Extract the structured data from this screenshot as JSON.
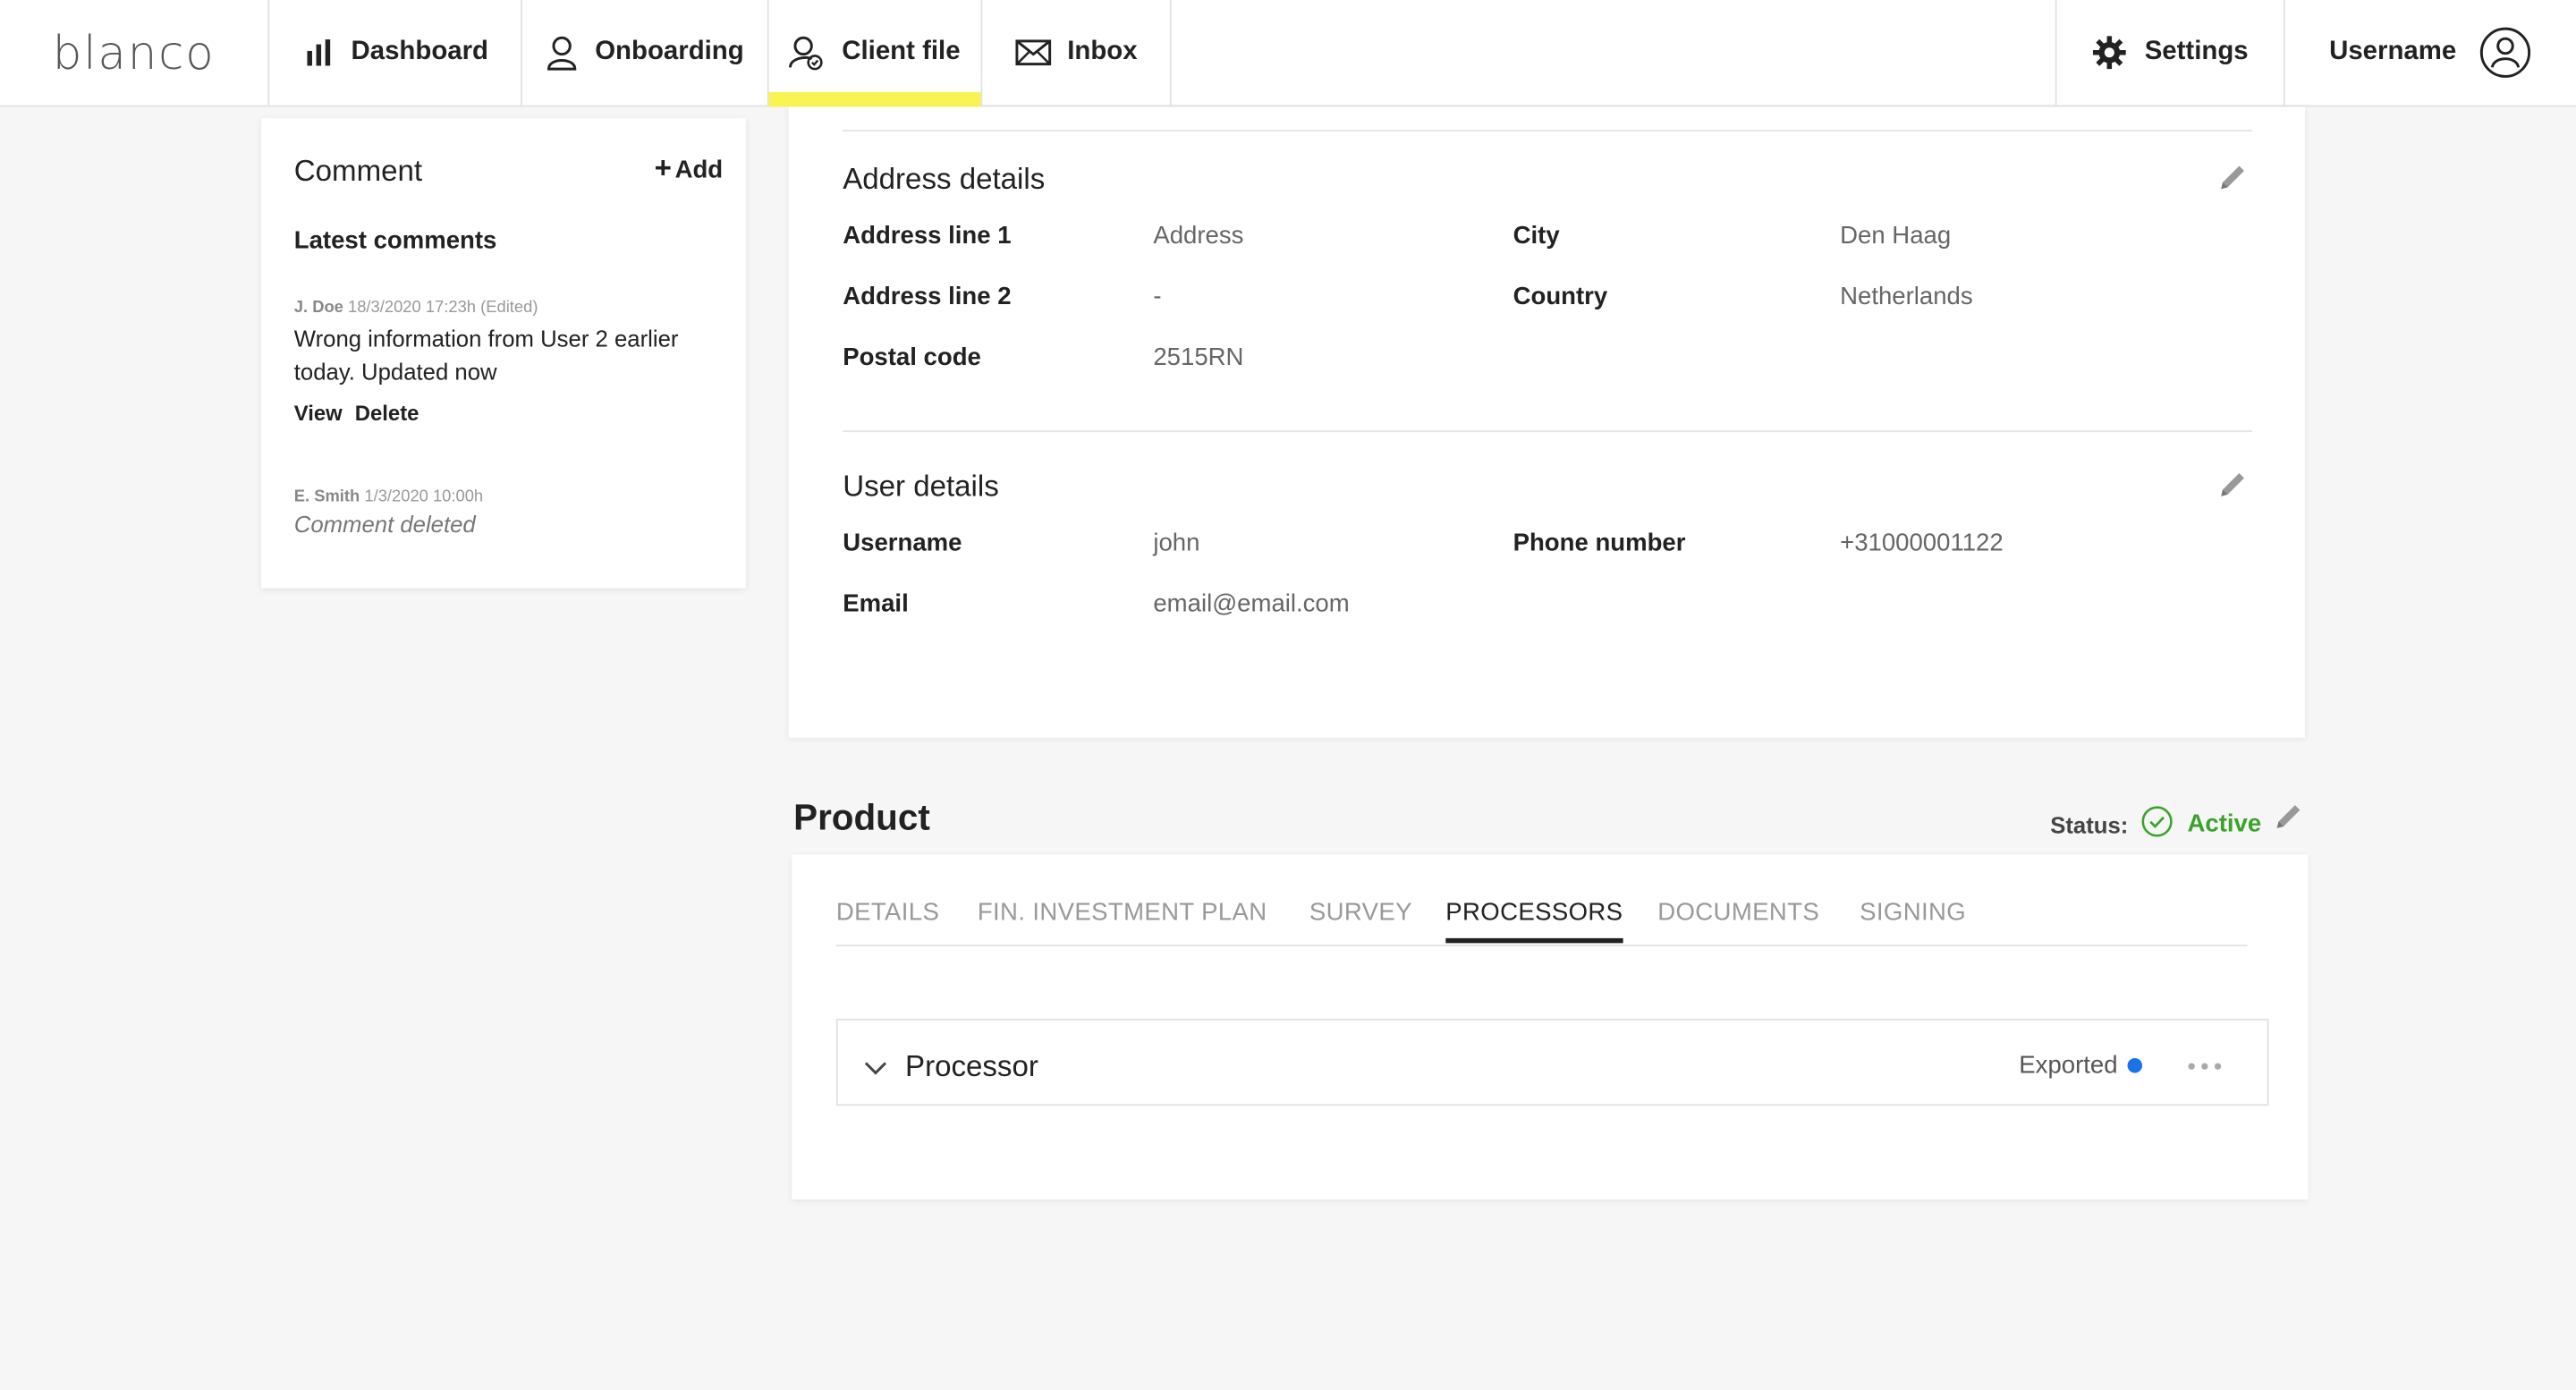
{
  "brand": {
    "logo_text": "blanco"
  },
  "nav": {
    "items": [
      {
        "label": "Dashboard",
        "icon": "bar-chart-icon"
      },
      {
        "label": "Onboarding",
        "icon": "user-icon"
      },
      {
        "label": "Client file",
        "icon": "user-check-icon",
        "active": true
      },
      {
        "label": "Inbox",
        "icon": "mail-icon"
      }
    ],
    "settings_label": "Settings",
    "username_label": "Username",
    "active_color": "#f8f553"
  },
  "comments": {
    "title": "Comment",
    "add_label": "Add",
    "latest_title": "Latest comments",
    "items": [
      {
        "author": "J. Doe",
        "timestamp": "18/3/2020 17:23h",
        "edited": "(Edited)",
        "text": "Wrong information from User 2 earlier today. Updated now",
        "view_label": "View",
        "delete_label": "Delete"
      },
      {
        "author": "E. Smith",
        "timestamp": "1/3/2020 10:00h",
        "text": "Comment deleted"
      }
    ]
  },
  "address": {
    "title": "Address details",
    "fields": {
      "line1_label": "Address line 1",
      "line1_value": "Address",
      "line2_label": "Address line 2",
      "line2_value": "-",
      "postal_label": "Postal code",
      "postal_value": "2515RN",
      "city_label": "City",
      "city_value": "Den Haag",
      "country_label": "Country",
      "country_value": "Netherlands"
    }
  },
  "user": {
    "title": "User details",
    "fields": {
      "username_label": "Username",
      "username_value": "john",
      "email_label": "Email",
      "email_value": "email@email.com",
      "phone_label": "Phone number",
      "phone_value": "+31000001122"
    }
  },
  "product": {
    "title": "Product",
    "status_label": "Status:",
    "status_value": "Active",
    "status_color": "#3aa32b",
    "tabs": [
      "DETAILS",
      "FIN. INVESTMENT PLAN",
      "SURVEY",
      "PROCESSORS",
      "DOCUMENTS",
      "SIGNING"
    ],
    "active_tab": "PROCESSORS",
    "processor": {
      "name": "Processor",
      "status": "Exported",
      "status_color": "#1a73e8"
    }
  }
}
